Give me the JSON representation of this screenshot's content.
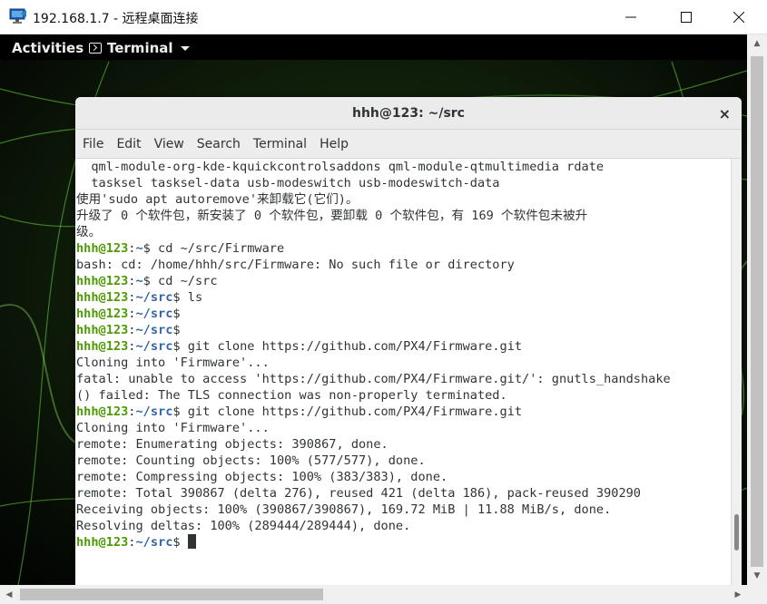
{
  "window": {
    "title": "192.168.1.7 - 远程桌面连接",
    "icon": "remote-desktop-icon",
    "controls": [
      "minimize-icon",
      "maximize-icon",
      "close-icon"
    ]
  },
  "topbar": {
    "activities": "Activities",
    "app_menu": "Terminal"
  },
  "terminal": {
    "title": "hhh@123: ~/src",
    "close": "×",
    "menu": [
      "File",
      "Edit",
      "View",
      "Search",
      "Terminal",
      "Help"
    ],
    "prompt_user": "hhh@123",
    "colors": {
      "user": "#4e9a06",
      "path": "#3465a4",
      "text": "#2e3436"
    },
    "lines": [
      {
        "text": "  qml-module-org-kde-kquickcontrolsaddons qml-module-qtmultimedia rdate"
      },
      {
        "text": "  tasksel tasksel-data usb-modeswitch usb-modeswitch-data"
      },
      {
        "text": "使用'sudo apt autoremove'来卸载它(它们)。"
      },
      {
        "text": "升级了 0 个软件包，新安装了 0 个软件包，要卸载 0 个软件包，有 169 个软件包未被升"
      },
      {
        "text": "级。"
      },
      {
        "prompt": "hhh@123",
        "sep": ":",
        "path": "~",
        "cmd": "$ cd ~/src/Firmware"
      },
      {
        "text": "bash: cd: /home/hhh/src/Firmware: No such file or directory"
      },
      {
        "prompt": "hhh@123",
        "sep": ":",
        "path": "~",
        "cmd": "$ cd ~/src"
      },
      {
        "prompt": "hhh@123",
        "sep": ":",
        "path": "~/src",
        "cmd": "$ ls"
      },
      {
        "prompt": "hhh@123",
        "sep": ":",
        "path": "~/src",
        "cmd": "$"
      },
      {
        "prompt": "hhh@123",
        "sep": ":",
        "path": "~/src",
        "cmd": "$"
      },
      {
        "prompt": "hhh@123",
        "sep": ":",
        "path": "~/src",
        "cmd": "$ git clone https://github.com/PX4/Firmware.git"
      },
      {
        "text": "Cloning into 'Firmware'..."
      },
      {
        "text": "fatal: unable to access 'https://github.com/PX4/Firmware.git/': gnutls_handshake"
      },
      {
        "text": "() failed: The TLS connection was non-properly terminated."
      },
      {
        "prompt": "hhh@123",
        "sep": ":",
        "path": "~/src",
        "cmd": "$ git clone https://github.com/PX4/Firmware.git"
      },
      {
        "text": "Cloning into 'Firmware'..."
      },
      {
        "text": "remote: Enumerating objects: 390867, done."
      },
      {
        "text": "remote: Counting objects: 100% (577/577), done."
      },
      {
        "text": "remote: Compressing objects: 100% (383/383), done."
      },
      {
        "text": "remote: Total 390867 (delta 276), reused 421 (delta 186), pack-reused 390290"
      },
      {
        "text": "Receiving objects: 100% (390867/390867), 169.72 MiB | 11.88 MiB/s, done."
      },
      {
        "text": "Resolving deltas: 100% (289444/289444), done."
      },
      {
        "prompt": "hhh@123",
        "sep": ":",
        "path": "~/src",
        "cmd": "$ ",
        "cursor": true
      }
    ]
  }
}
